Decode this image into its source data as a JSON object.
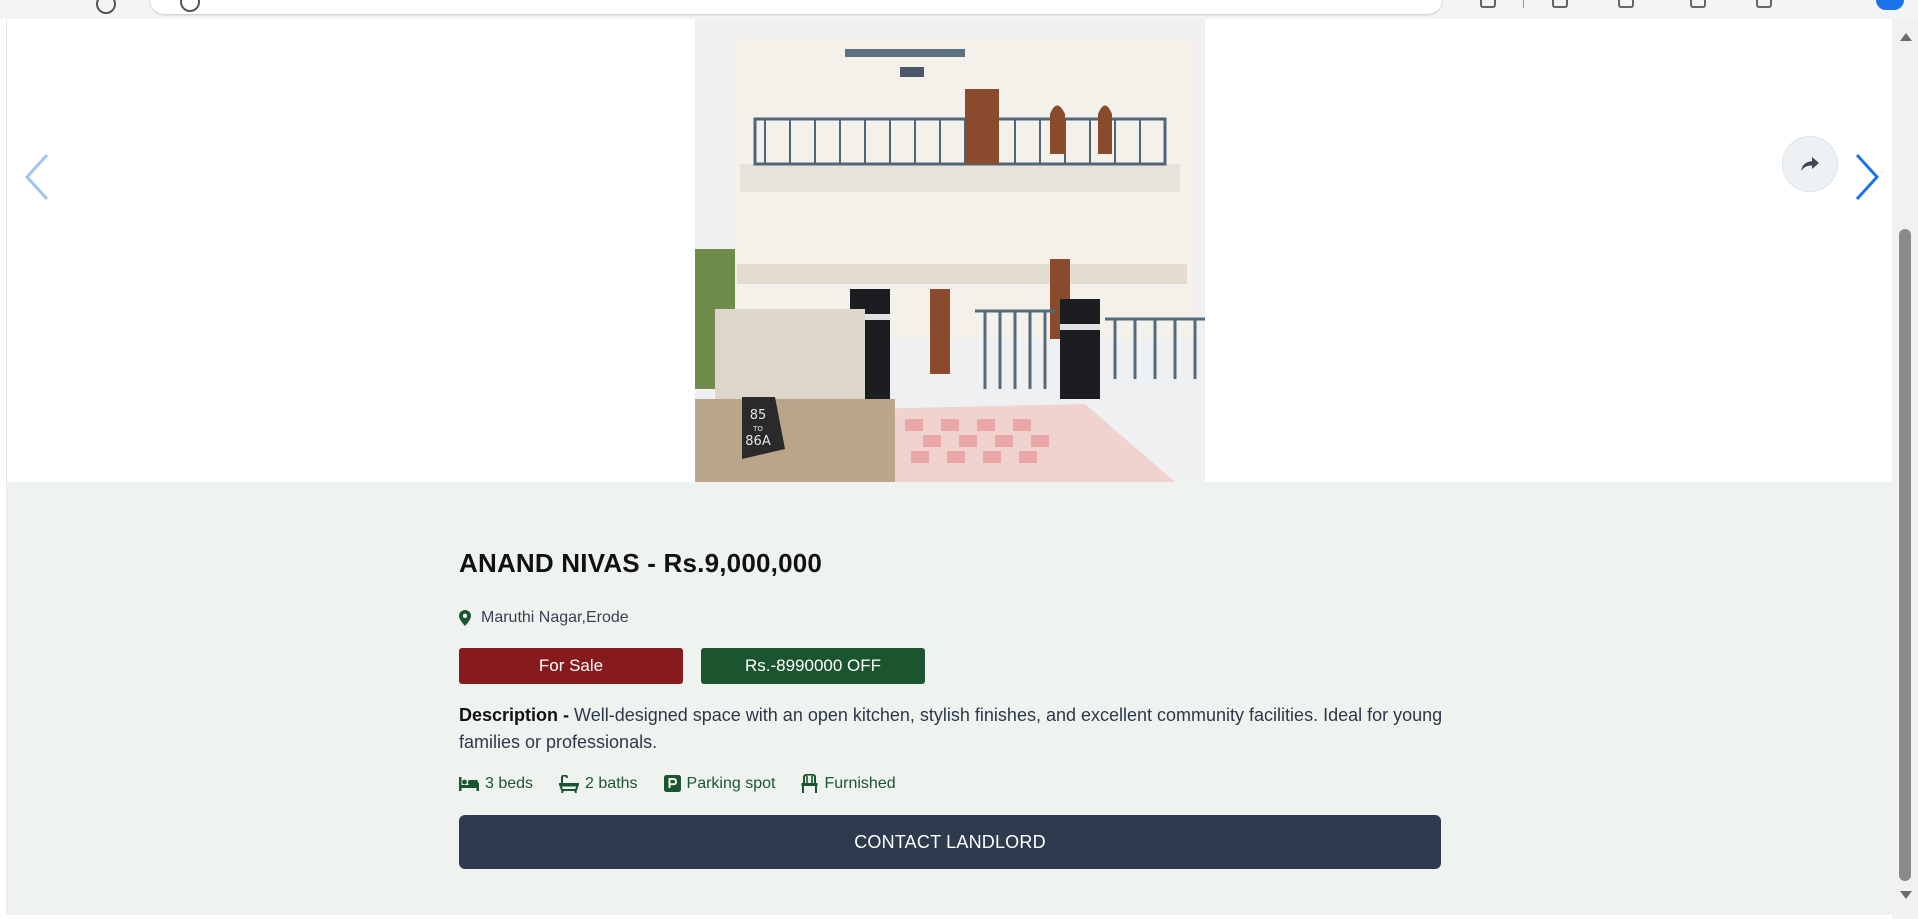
{
  "listing": {
    "title": "ANAND NIVAS - Rs.9,000,000",
    "location": "Maruthi Nagar,Erode",
    "sale_badge": "For Sale",
    "discount_badge": "Rs.-8990000 OFF",
    "description_label": "Description -",
    "description_text": "Well-designed space with an open kitchen, stylish finishes, and excellent community facilities. Ideal for young families or professionals.",
    "features": [
      {
        "icon": "bed-icon",
        "label": "3 beds"
      },
      {
        "icon": "bath-icon",
        "label": "2 baths"
      },
      {
        "icon": "parking-icon",
        "label": "Parking spot"
      },
      {
        "icon": "chair-icon",
        "label": "Furnished"
      }
    ],
    "contact_button": "CONTACT LANDLORD",
    "photo_plate": "85 TO 86A"
  },
  "carousel": {
    "prev_icon": "chevron-left-icon",
    "next_icon": "chevron-right-icon",
    "share_icon": "share-icon"
  },
  "colors": {
    "sale_badge": "#861a1c",
    "discount_badge": "#1b5530",
    "contact_button": "#2e3a4d",
    "details_background": "#eff3f0",
    "carousel_arrow": "#1a73e8"
  }
}
